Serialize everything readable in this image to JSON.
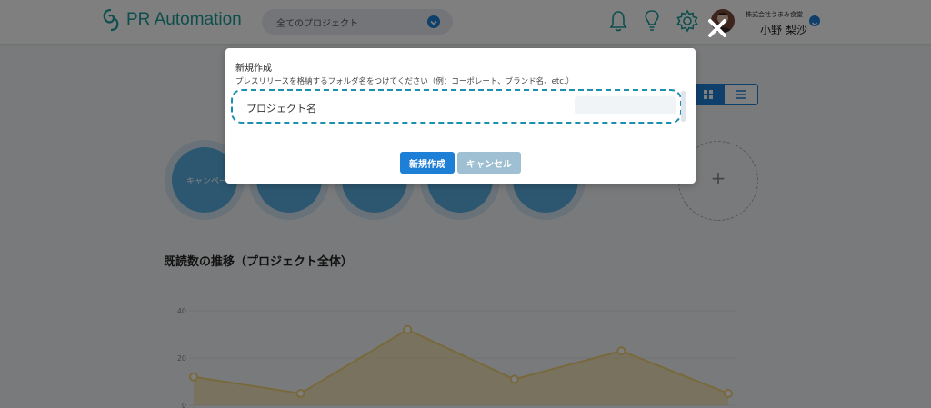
{
  "header": {
    "app_name": "PR Automation",
    "project_select": "全てのプロジェクト",
    "company": "株式会社うまみ食堂",
    "user_name": "小野 梨沙"
  },
  "projects": {
    "first_label": "キャンペー"
  },
  "add_project_symbol": "+",
  "chart_data": {
    "type": "area",
    "title": "既読数の推移（プロジェクト全体）",
    "yticks": [
      0,
      20,
      40
    ],
    "ylim": [
      0,
      42
    ],
    "points": [
      12,
      5,
      32,
      11,
      23,
      5
    ],
    "grid": true
  },
  "modal": {
    "title": "新規作成",
    "description": "プレスリリースを格納するフォルダ名をつけてください（例：コーポレート、ブランド名、etc.）",
    "field_label": "プロジェクト名",
    "field_value": "",
    "create_button": "新規作成",
    "cancel_button": "キャンセル"
  },
  "colors": {
    "primary": "#1e7fd6",
    "brand": "#1a9c9a",
    "highlight": "#1b8fb0",
    "chart_line": "#f1d27a"
  }
}
